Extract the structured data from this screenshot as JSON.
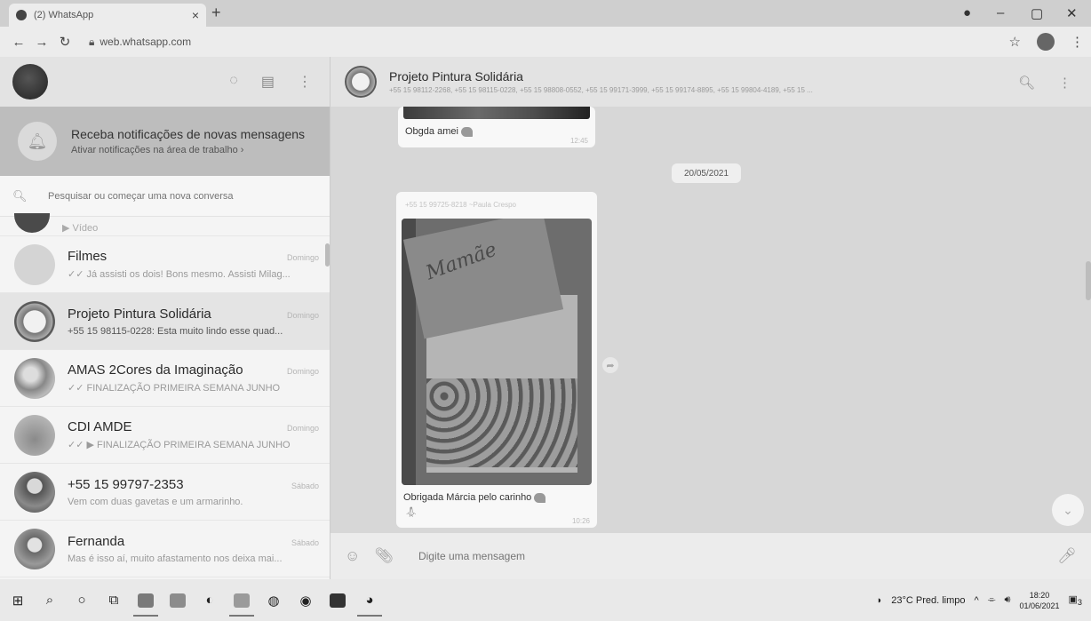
{
  "browser": {
    "tab_title": "(2) WhatsApp",
    "tab_close": "×",
    "new_tab": "+",
    "url": "web.whatsapp.com",
    "win_min": "–",
    "win_max": "▢",
    "win_close": "✕"
  },
  "sidebar": {
    "notification": {
      "title": "Receba notificações de novas mensagens",
      "subtitle": "Ativar notificações na área de trabalho ›"
    },
    "search_placeholder": "Pesquisar ou começar uma nova conversa",
    "partial_chat": {
      "message": "▶ Vídeo"
    },
    "chats": [
      {
        "name": "Filmes",
        "time": "Domingo",
        "message": "✓✓ Já assisti os dois! Bons mesmo. Assisti Milag...",
        "color": "#cfcfcf"
      },
      {
        "name": "Projeto Pintura Solidária",
        "time": "Domingo",
        "message": "+55 15 98115-0228: Esta muito lindo esse quad...",
        "color": "#8a8a8a"
      },
      {
        "name": "AMAS 2Cores da Imaginação",
        "time": "Domingo",
        "message": "✓✓ FINALIZAÇÃO PRIMEIRA SEMANA JUNHO",
        "color": "#9a9a9a"
      },
      {
        "name": "CDI AMDE",
        "time": "Domingo",
        "message": "✓✓ ▶ FINALIZAÇÃO PRIMEIRA SEMANA JUNHO",
        "color": "#a8a8a8"
      },
      {
        "name": "+55 15 99797-2353",
        "time": "Sábado",
        "message": "Vem com duas gavetas e um armarinho.",
        "color": "#6e6e6e"
      },
      {
        "name": "Fernanda",
        "time": "Sábado",
        "message": "Mas é isso aí, muito afastamento nos deixa mai...",
        "color": "#7c7c7c"
      }
    ]
  },
  "conversation": {
    "title": "Projeto Pintura Solidária",
    "participants": "+55 15 98112-2268, +55 15 98115-0228, +55 15 98808-0552, +55 15 99171-3999, +55 15 99174-8895, +55 15 99804-4189, +55 15 ...",
    "messages": [
      {
        "text": "Obgda amei",
        "time": "12:45"
      },
      {
        "sender": "+55 15 99725-8218 ~Paula Crespo",
        "text": "Obrigada Márcia  pelo carinho",
        "time": "10:26",
        "photo_text": "Mamãe"
      }
    ],
    "date_separator": "20/05/2021",
    "composer_placeholder": "Digite uma mensagem"
  },
  "taskbar": {
    "weather": "23°C  Pred. limpo",
    "time": "18:20",
    "date": "01/06/2021",
    "notifications_count": "3"
  }
}
